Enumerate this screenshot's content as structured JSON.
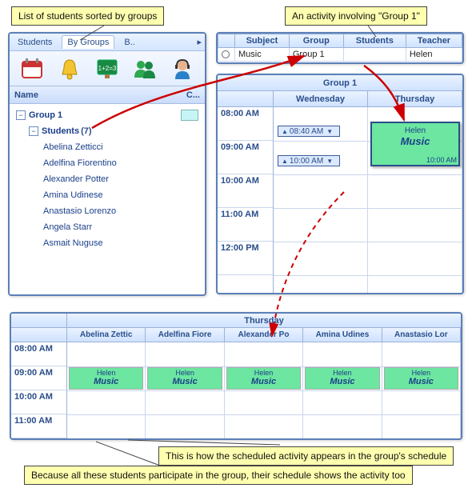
{
  "callouts": {
    "top_left": "List of students sorted by groups",
    "top_right": "An activity involving \"Group 1\"",
    "mid": "This is how the scheduled activity appears in the group's schedule",
    "bottom": "Because all these students participate in the group, their schedule shows the activity too"
  },
  "tabs": {
    "students": "Students",
    "by_groups": "By Groups",
    "b": "B.."
  },
  "tree_header": {
    "name": "Name",
    "c": "C..."
  },
  "group": {
    "name": "Group 1",
    "students_label": "Students",
    "count": "(7)",
    "students": [
      "Abelina Zetticci",
      "Adelfina Fiorentino",
      "Alexander Potter",
      "Amina Udinese",
      "Anastasio Lorenzo",
      "Angela Starr",
      "Asmait Nuguse"
    ]
  },
  "activity": {
    "headers": {
      "subject": "Subject",
      "group": "Group",
      "students": "Students",
      "teacher": "Teacher"
    },
    "row": {
      "subject": "Music",
      "group": "Group 1",
      "students": "",
      "teacher": "Helen"
    }
  },
  "group_schedule": {
    "title": "Group 1",
    "days": [
      "Wednesday",
      "Thursday"
    ],
    "times": [
      "08:00 AM",
      "09:00 AM",
      "10:00 AM",
      "11:00 AM",
      "12:00 PM"
    ],
    "tags": [
      "08:40 AM",
      "10:00 AM"
    ],
    "event": {
      "teacher": "Helen",
      "subject": "Music",
      "end": "10:00 AM"
    }
  },
  "student_schedule": {
    "day": "Thursday",
    "names": [
      "Abelina Zettic",
      "Adelfina Fiore",
      "Alexander Po",
      "Amina Udines",
      "Anastasio Lor"
    ],
    "times": [
      "08:00 AM",
      "09:00 AM",
      "10:00 AM",
      "11:00 AM"
    ],
    "event": {
      "teacher": "Helen",
      "subject": "Music"
    }
  }
}
